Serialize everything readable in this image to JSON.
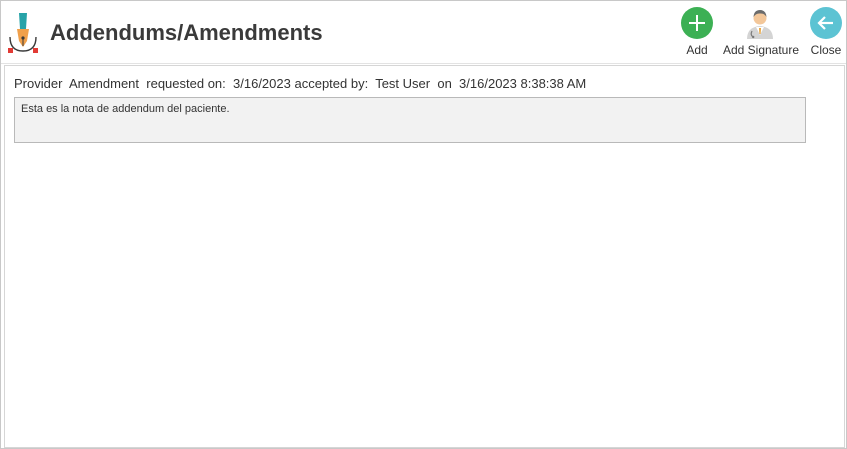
{
  "window": {
    "title": "Addendums/Amendments",
    "title_icon": "pen-nib-icon"
  },
  "toolbar": {
    "add_label": "Add",
    "add_icon": "plus-circle-icon",
    "signature_label": "Add Signature",
    "signature_icon": "doctor-avatar-icon",
    "close_label": "Close",
    "close_icon": "back-arrow-circle-icon"
  },
  "amendment": {
    "provider_label": "Provider",
    "type": "Amendment",
    "requested_label": "requested on:",
    "requested_date": "3/16/2023",
    "accepted_label": "accepted by:",
    "accepted_user": "Test User",
    "on_label": "on",
    "accepted_datetime": "3/16/2023 8:38:38 AM",
    "note_text": "Esta es la nota de addendum del paciente."
  },
  "colors": {
    "add_green": "#3cb054",
    "close_teal": "#5cc3d3",
    "note_bg": "#f2f2f2"
  }
}
